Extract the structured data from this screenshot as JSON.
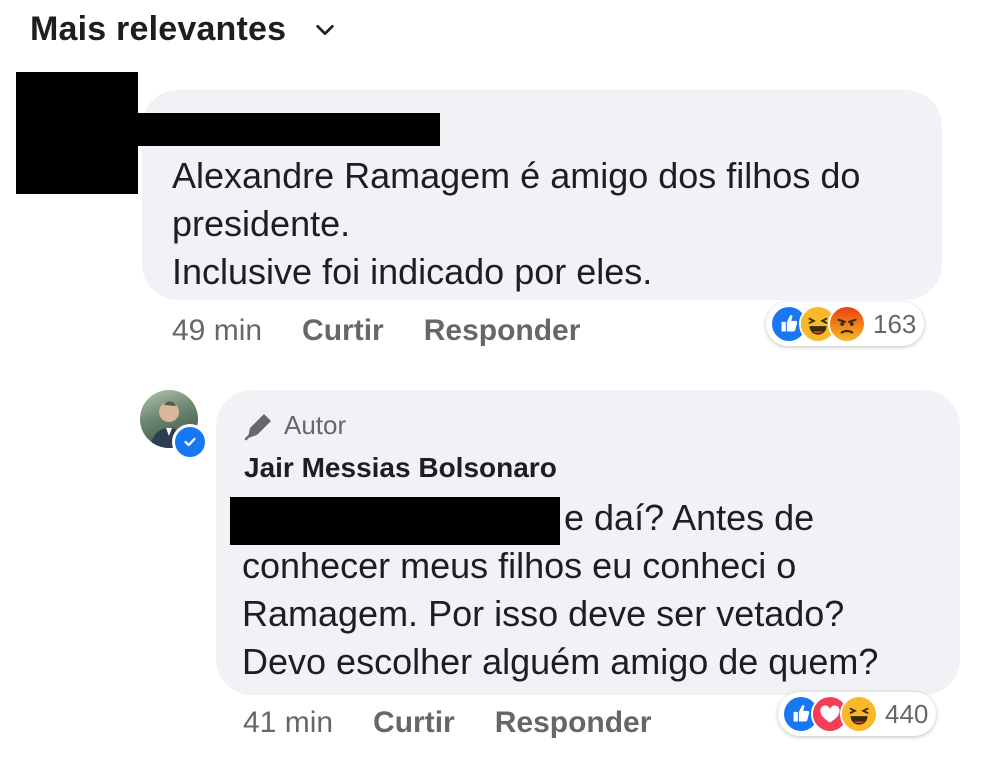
{
  "header": {
    "sort_label": "Mais relevantes",
    "chevron_icon": "chevron-down-icon"
  },
  "comment1": {
    "text_lines": [
      "Alexandre Ramagem é amigo dos filhos do",
      "presidente.",
      "Inclusive foi indicado por eles."
    ],
    "time": "49 min",
    "like_label": "Curtir",
    "reply_label": "Responder",
    "reactions": {
      "icons": [
        "like-icon",
        "haha-icon",
        "angry-icon"
      ],
      "count": "163"
    }
  },
  "comment2": {
    "author_badge_label": "Autor",
    "author_name": "Jair Messias Bolsonaro",
    "text_lines": [
      "e daí? Antes de",
      "conhecer meus filhos eu conheci o",
      "Ramagem. Por isso deve ser vetado?",
      "Devo escolher alguém amigo de quem?"
    ],
    "time": "41 min",
    "like_label": "Curtir",
    "reply_label": "Responder",
    "reactions": {
      "icons": [
        "like-icon",
        "love-icon",
        "haha-icon"
      ],
      "count": "440"
    }
  },
  "colors": {
    "bubble": "#f0f2f5",
    "text": "#1c1e21",
    "secondary_text": "#65676b",
    "like_blue": "#1877f2",
    "love_red": "#f33e58",
    "haha_yellow": "#f7b928",
    "angry_orange": "#e9710f"
  }
}
